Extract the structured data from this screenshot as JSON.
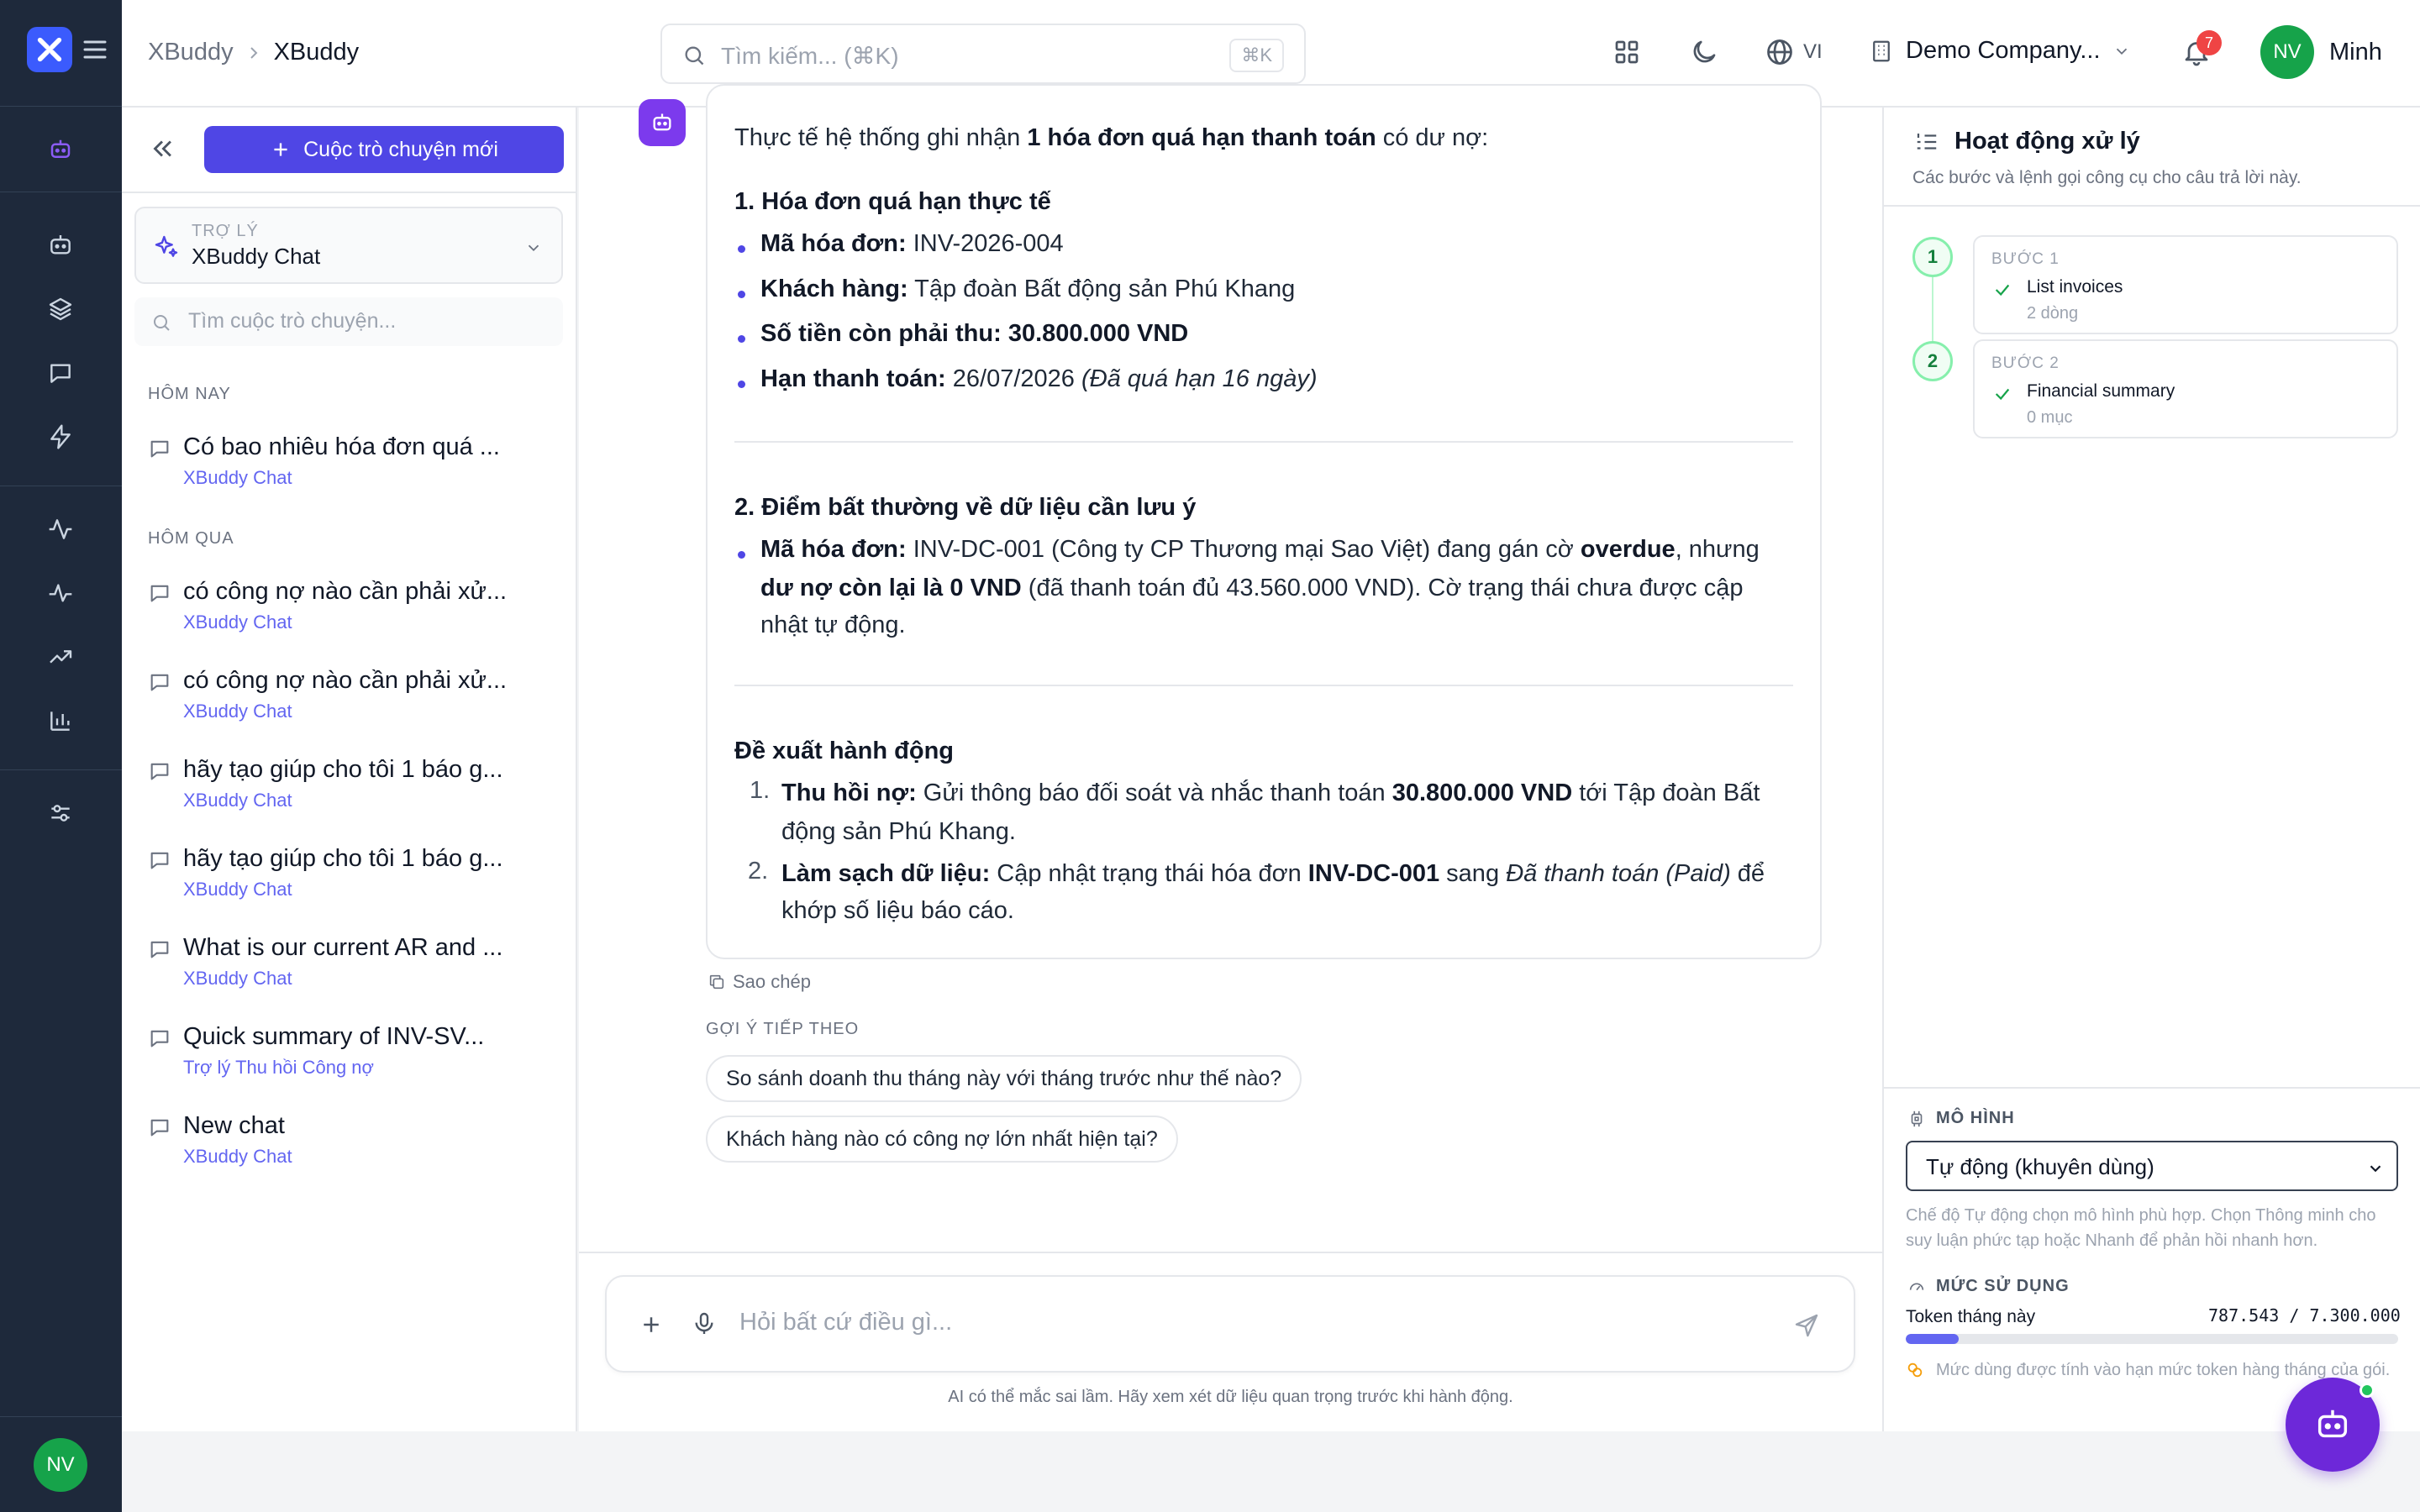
{
  "app": {
    "breadcrumb": [
      "XBuddy",
      "XBuddy"
    ],
    "search_placeholder": "Tìm kiếm... (⌘K)",
    "search_shortcut": "⌘K",
    "language": "VI",
    "company": "Demo Company...",
    "notifications_count": "7",
    "user_initials": "NV",
    "user_name": "Minh",
    "accent_color": "#4f46e5"
  },
  "rail": {
    "icons": [
      "logo-icon",
      "menu-icon",
      "bot-icon",
      "robot-icon",
      "layers-icon",
      "chat-icon",
      "bolt-icon",
      "activity-icon",
      "pulse-icon",
      "trending-icon",
      "bar-chart-icon",
      "sliders-icon"
    ],
    "user_initials": "NV"
  },
  "sidebar": {
    "new_chat_label": "Cuộc trò chuyện mới",
    "assistant_label": "TRỢ LÝ",
    "assistant_value": "XBuddy Chat",
    "search_placeholder": "Tìm cuộc trò chuyện...",
    "groups": [
      {
        "label": "HÔM NAY",
        "items": [
          {
            "title": "Có bao nhiêu hóa đơn quá ...",
            "assistant": "XBuddy Chat"
          }
        ]
      },
      {
        "label": "HÔM QUA",
        "items": [
          {
            "title": "có công nợ nào cần phải xử...",
            "assistant": "XBuddy Chat"
          },
          {
            "title": "có công nợ nào cần phải xử...",
            "assistant": "XBuddy Chat"
          },
          {
            "title": "hãy tạo giúp cho tôi 1 báo g...",
            "assistant": "XBuddy Chat"
          },
          {
            "title": "hãy tạo giúp cho tôi 1 báo g...",
            "assistant": "XBuddy Chat"
          },
          {
            "title": "What is our current AR and ...",
            "assistant": "XBuddy Chat"
          },
          {
            "title": "Quick summary of INV-SV...",
            "assistant": "Trợ lý Thu hồi Công nợ"
          },
          {
            "title": "New chat",
            "assistant": "XBuddy Chat"
          }
        ]
      }
    ]
  },
  "message": {
    "intro_pre": "Thực tế hệ thống ghi nhận ",
    "intro_bold": "1 hóa đơn quá hạn thanh toán",
    "intro_post": " có dư nợ:",
    "sec1_title": "1. Hóa đơn quá hạn thực tế",
    "sec1_items": [
      {
        "label": "Mã hóa đơn:",
        "value": " INV-2026-004"
      },
      {
        "label": "Khách hàng:",
        "value": " Tập đoàn Bất động sản Phú Khang"
      },
      {
        "label": "Số tiền còn phải thu:",
        "value": " 30.800.000 VND"
      },
      {
        "label": "Hạn thanh toán:",
        "value": " 26/07/2026 ",
        "italic": "(Đã quá hạn 16 ngày)"
      }
    ],
    "sec2_title": "2. Điểm bất thường về dữ liệu cần lưu ý",
    "sec2_label": "Mã hóa đơn:",
    "sec2_line1": " INV-DC-001 (Công ty CP Thương mại Sao Việt) đang gán cờ ",
    "sec2_line1_bold": "overdue",
    "sec2_line1_end": ", nhưng",
    "sec2_line2_bold": "dư nợ còn lại là 0 VND",
    "sec2_line2": " (đã thanh toán đủ 43.560.000 VND). Cờ trạng thái chưa được cập",
    "sec2_line3": "nhật tự động.",
    "sec3_title": "Đề xuất hành động",
    "actions": [
      {
        "num": "1.",
        "label": "Thu hồi nợ:",
        "line1": " Gửi thông báo đối soát và nhắc thanh toán ",
        "line1_bold": "30.800.000 VND",
        "line1_end": " tới Tập đoàn Bất",
        "line2": "động sản Phú Khang."
      },
      {
        "num": "2.",
        "label": "Làm sạch dữ liệu:",
        "line1": " Cập nhật trạng thái hóa đơn ",
        "line1_bold": "INV-DC-001",
        "line1_mid": " sang ",
        "line1_italic": "Đã thanh toán (Paid)",
        "line1_end": " để",
        "line2": "khớp số liệu báo cáo."
      }
    ],
    "copy_label": "Sao chép"
  },
  "suggestions": {
    "label": "GỢI Ý TIẾP THEO",
    "items": [
      "So sánh doanh thu tháng này với tháng trước như thế nào?",
      "Khách hàng nào có công nợ lớn nhất hiện tại?"
    ]
  },
  "composer": {
    "placeholder": "Hỏi bất cứ điều gì...",
    "disclaimer": "AI có thể mắc sai lầm. Hãy xem xét dữ liệu quan trọng trước khi hành động."
  },
  "activity": {
    "title": "Hoạt động xử lý",
    "subtitle": "Các bước và lệnh gọi công cụ cho câu trả lời này.",
    "steps": [
      {
        "num": "1",
        "label": "BƯỚC 1",
        "name": "List invoices",
        "count": "2 dòng"
      },
      {
        "num": "2",
        "label": "BƯỚC 2",
        "name": "Financial summary",
        "count": "0 mục"
      }
    ],
    "model_label": "MÔ HÌNH",
    "model_value": "Tự động (khuyên dùng)",
    "model_help": "Chế độ Tự động chọn mô hình phù hợp. Chọn Thông minh cho suy luận phức tạp hoặc Nhanh để phản hồi nhanh hơn.",
    "usage_label": "MỨC SỬ DỤNG",
    "token_label": "Token tháng này",
    "token_value": "787.543 / 7.300.000",
    "token_fraction": 0.1079,
    "token_note": "Mức dùng được tính vào hạn mức token hàng tháng của gói."
  }
}
